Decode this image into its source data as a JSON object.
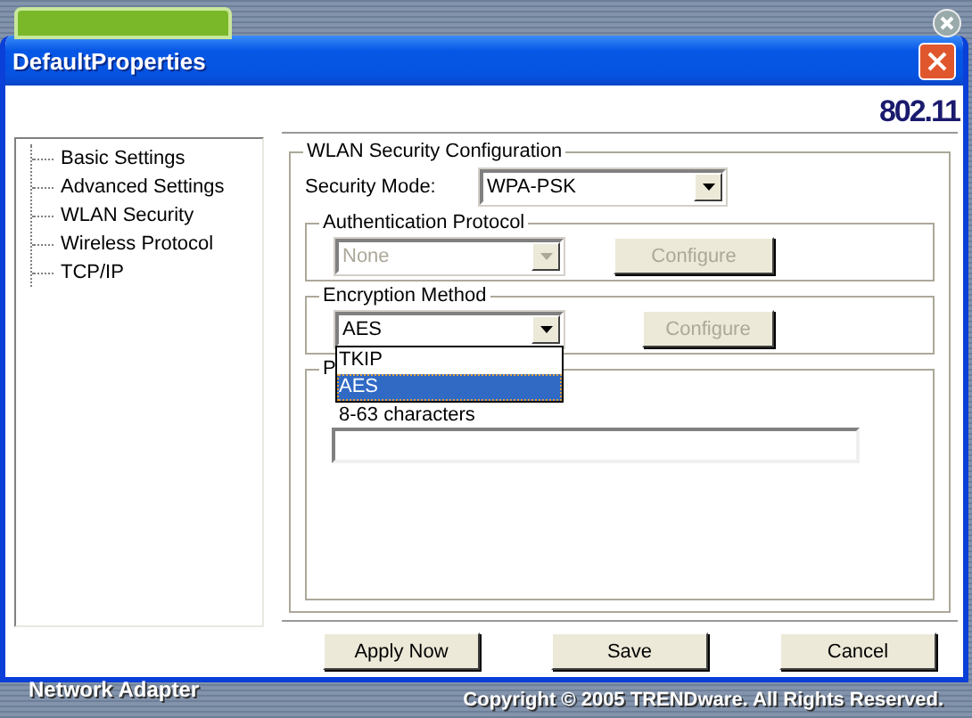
{
  "window": {
    "title": "DefaultProperties",
    "badge": "802.11"
  },
  "sidebar": {
    "items": [
      {
        "label": "Basic Settings"
      },
      {
        "label": "Advanced Settings"
      },
      {
        "label": "WLAN Security"
      },
      {
        "label": "Wireless Protocol"
      },
      {
        "label": "TCP/IP"
      }
    ]
  },
  "security": {
    "title": "WLAN Security Configuration",
    "security_mode": {
      "label": "Security Mode:",
      "value": "WPA-PSK"
    },
    "authentication": {
      "title": "Authentication Protocol",
      "value": "None",
      "disabled": true,
      "button": {
        "label": "Configure",
        "disabled": true
      }
    },
    "encryption": {
      "title": "Encryption Method",
      "value": "AES",
      "disabled": false,
      "button": {
        "label": "Configure",
        "disabled": true
      },
      "dropdown": {
        "expanded": true,
        "options": [
          {
            "label": "TKIP",
            "selected": false
          },
          {
            "label": "AES",
            "selected": true
          }
        ]
      }
    },
    "passphrase": {
      "title": "P",
      "hint": "8-63 characters"
    }
  },
  "buttons": [
    {
      "label": "Apply Now"
    },
    {
      "label": "Save"
    },
    {
      "label": "Cancel"
    }
  ],
  "background_app": {
    "footer_title": "Network Adapter",
    "copyright": "Copyright © 2005 TRENDware. All Rights Reserved."
  }
}
